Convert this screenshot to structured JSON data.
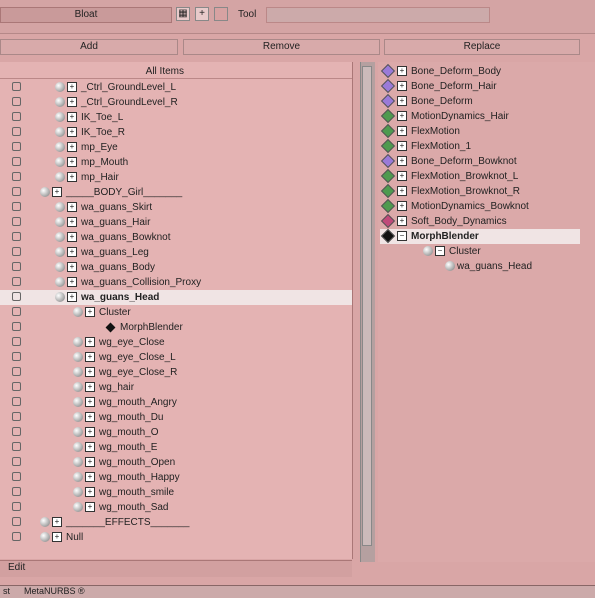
{
  "toolbar": {
    "bloat_label": "Bloat",
    "plus_label": "+",
    "tool_label": "Tool"
  },
  "buttons": {
    "add": "Add",
    "remove": "Remove",
    "replace": "Replace"
  },
  "left": {
    "header": "All Items",
    "items": [
      {
        "label": "_Ctrl_GroundLevel_L",
        "indent": 0
      },
      {
        "label": "_Ctrl_GroundLevel_R",
        "indent": 0
      },
      {
        "label": "IK_Toe_L",
        "indent": 0
      },
      {
        "label": "IK_Toe_R",
        "indent": 0
      },
      {
        "label": "mp_Eye",
        "indent": 0
      },
      {
        "label": "mp_Mouth",
        "indent": 0
      },
      {
        "label": "mp_Hair",
        "indent": 0
      },
      {
        "label": "_____BODY_Girl_______",
        "indent": -1
      },
      {
        "label": "wa_guans_Skirt",
        "indent": 0
      },
      {
        "label": "wa_guans_Hair",
        "indent": 0
      },
      {
        "label": "wa_guans_Bowknot",
        "indent": 0
      },
      {
        "label": "wa_guans_Leg",
        "indent": 0
      },
      {
        "label": "wa_guans_Body",
        "indent": 0
      },
      {
        "label": "wa_guans_Collision_Proxy",
        "indent": 0
      },
      {
        "label": "wa_guans_Head",
        "indent": 0,
        "bold": true,
        "selected": true
      },
      {
        "label": "Cluster",
        "indent": 1
      },
      {
        "label": "MorphBlender",
        "indent": 2,
        "diamond": true
      },
      {
        "label": "wg_eye_Close",
        "indent": 1
      },
      {
        "label": "wg_eye_Close_L",
        "indent": 1
      },
      {
        "label": "wg_eye_Close_R",
        "indent": 1
      },
      {
        "label": "wg_hair",
        "indent": 1
      },
      {
        "label": "wg_mouth_Angry",
        "indent": 1
      },
      {
        "label": "wg_mouth_Du",
        "indent": 1
      },
      {
        "label": "wg_mouth_O",
        "indent": 1
      },
      {
        "label": "wg_mouth_E",
        "indent": 1
      },
      {
        "label": "wg_mouth_Open",
        "indent": 1
      },
      {
        "label": "wg_mouth_Happy",
        "indent": 1
      },
      {
        "label": "wg_mouth_smile",
        "indent": 1
      },
      {
        "label": "wg_mouth_Sad",
        "indent": 1
      },
      {
        "label": "_______EFFECTS_______",
        "indent": -1
      },
      {
        "label": "Null",
        "indent": -1
      }
    ]
  },
  "right": {
    "items": [
      {
        "label": "Bone_Deform_Body",
        "color": "#9a7ad8"
      },
      {
        "label": "Bone_Deform_Hair",
        "color": "#9a7ad8"
      },
      {
        "label": "Bone_Deform",
        "color": "#9a7ad8"
      },
      {
        "label": "MotionDynamics_Hair",
        "color": "#4f9a4f"
      },
      {
        "label": "FlexMotion",
        "color": "#4f9a4f"
      },
      {
        "label": "FlexMotion_1",
        "color": "#4f9a4f"
      },
      {
        "label": "Bone_Deform_Bowknot",
        "color": "#9a7ad8"
      },
      {
        "label": "FlexMotion_Browknot_L",
        "color": "#4f9a4f"
      },
      {
        "label": "FlexMotion_Browknot_R",
        "color": "#4f9a4f"
      },
      {
        "label": "MotionDynamics_Bowknot",
        "color": "#4f9a4f"
      },
      {
        "label": "Soft_Body_Dynamics",
        "color": "#c04a7a"
      },
      {
        "label": "MorphBlender",
        "color": "#111111",
        "bold": true
      },
      {
        "label": "Cluster",
        "color": ""
      },
      {
        "label": "wa_guans_Head",
        "color": ""
      }
    ]
  },
  "status": {
    "edit": "Edit",
    "tab": "MetaNURBS ®",
    "tab_prefix": "st"
  }
}
